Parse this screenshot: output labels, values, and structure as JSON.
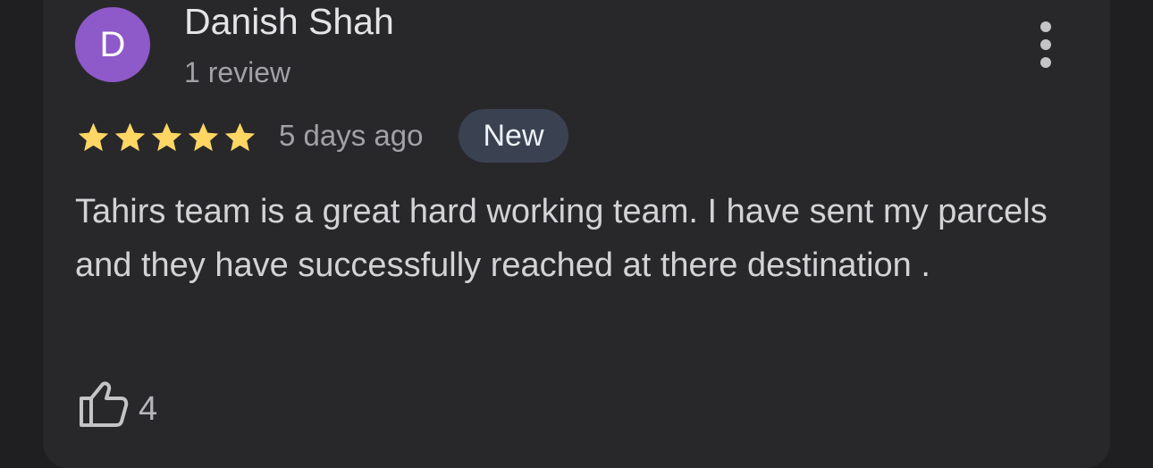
{
  "review": {
    "author": {
      "initial": "D",
      "name": "Danish Shah",
      "review_count": "1 review",
      "avatar_color": "#8e59c8"
    },
    "rating": 5,
    "rating_max": 5,
    "timestamp": "5 days ago",
    "badge": "New",
    "text": "Tahirs team is a great hard working team. I have sent my parcels and they have successfully reached at there destination .",
    "likes": "4"
  },
  "icons": {
    "more": "more-vert-icon",
    "star": "star-filled-icon",
    "like": "thumbs-up-icon"
  },
  "colors": {
    "star": "#fdd663",
    "card_background": "#28282b",
    "page_background": "#1f1f21",
    "badge_background": "#3a4252"
  }
}
